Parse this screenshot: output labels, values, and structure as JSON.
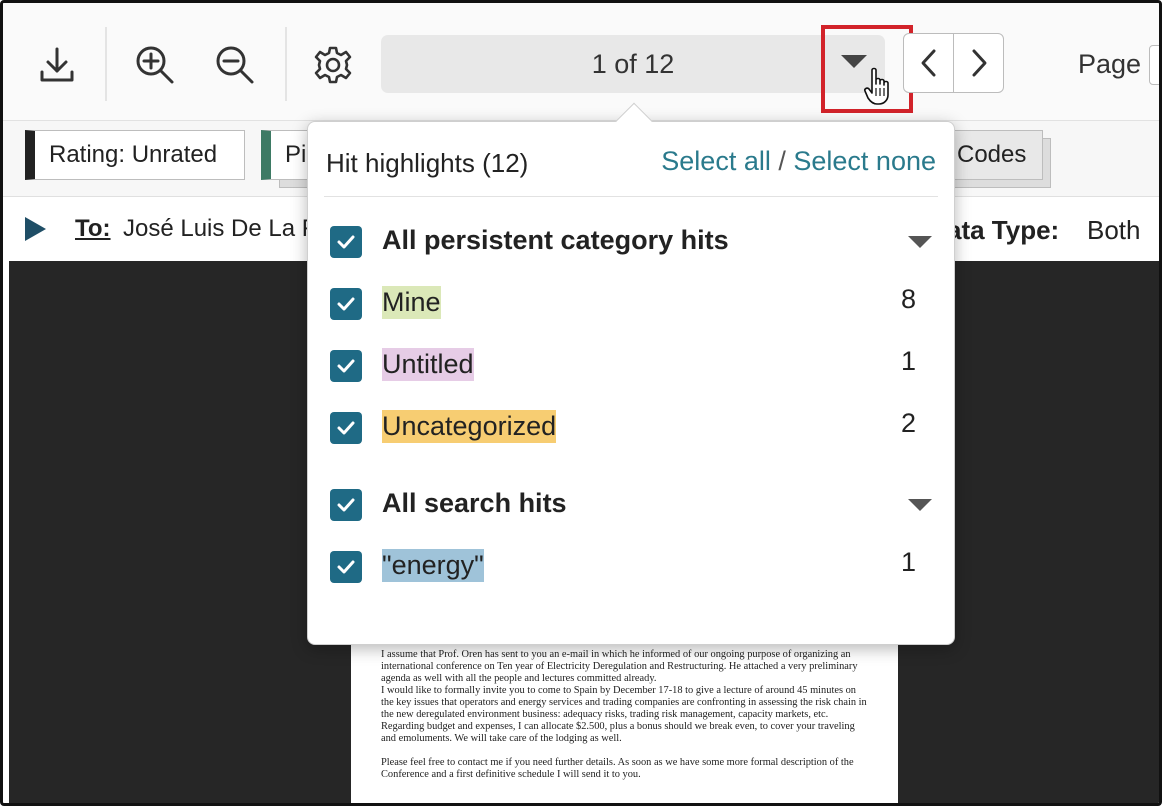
{
  "toolbar": {
    "hits_selector_text": "1 of 12",
    "page_label": "Page"
  },
  "tags": {
    "rating": "Rating: Unrated",
    "pi": "Pi",
    "codes": "Codes"
  },
  "header": {
    "to_label": "To:",
    "to_value": "José Luis De La F",
    "data_type_label": "ata Type:",
    "data_type_value": "Both"
  },
  "popover": {
    "title": "Hit highlights (12)",
    "select_all": "Select all",
    "separator": "/",
    "select_none": "Select none",
    "groups": [
      {
        "label": "All persistent category hits",
        "checked": true,
        "items": [
          {
            "label": "Mine",
            "count": "8",
            "color": "#dbe8b8",
            "checked": true
          },
          {
            "label": "Untitled",
            "count": "1",
            "color": "#e6cce6",
            "checked": true
          },
          {
            "label": "Uncategorized",
            "count": "2",
            "color": "#f7cd72",
            "checked": true
          }
        ]
      },
      {
        "label": "All search hits",
        "checked": true,
        "items": [
          {
            "label": "\"energy\"",
            "count": "1",
            "color": "#9fc3d9",
            "checked": true
          }
        ]
      }
    ]
  },
  "document": {
    "paragraphs": [
      "I assume that Prof. Oren has sent to you an e-mail in which he informed of our ongoing purpose of organizing an international conference on Ten year of Electricity Deregulation and Restructuring. He attached a very preliminary agenda as well with all the people and lectures committed already.",
      "I would like to formally invite you to come to Spain by December 17-18 to give a lecture of around 45 minutes on the key issues that operators and energy services and trading companies are confronting in assessing the risk chain in the new deregulated environment business: adequacy risks, trading risk management, capacity markets, etc.",
      "Regarding budget and expenses, I can allocate $2.500, plus a bonus should we break even, to cover your traveling and emoluments. We will take care of the lodging as well.",
      "Please feel free to contact me if you need further details. As soon as we have some more formal description of the Conference and a first definitive schedule I will send it to you."
    ]
  },
  "colors": {
    "accent": "#2a7a8c",
    "checkbox": "#1f6a85",
    "highlight_box": "#d2232a"
  }
}
